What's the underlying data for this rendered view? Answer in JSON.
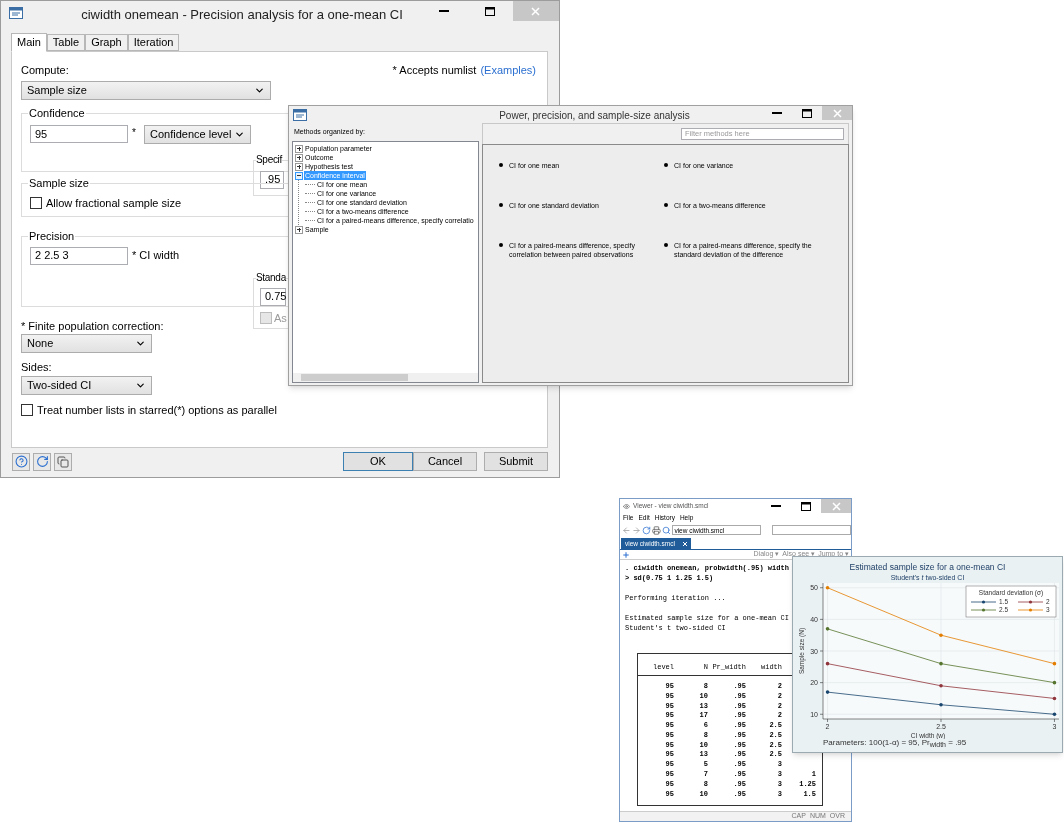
{
  "dialog": {
    "title": "ciwidth onemean - Precision analysis for a one-mean CI",
    "tabs": [
      {
        "label": "Main",
        "selected": true
      },
      {
        "label": "Table",
        "selected": false
      },
      {
        "label": "Graph",
        "selected": false
      },
      {
        "label": "Iteration",
        "selected": false
      }
    ],
    "compute_label": "Compute:",
    "compute_value": "Sample size",
    "numlist_note": "* Accepts numlist",
    "examples_link": "(Examples)",
    "confidence": {
      "legend": "Confidence",
      "value": "95",
      "star": "*",
      "type": "Confidence level",
      "specify_legend": "Specif",
      "specify_value": ".95"
    },
    "sample_size": {
      "legend": "Sample size",
      "checkbox": {
        "label": "Allow fractional sample size",
        "checked": false
      }
    },
    "precision": {
      "legend": "Precision",
      "value": "2 2.5 3",
      "label": "* CI width",
      "std_legend": "Standa",
      "std_value": "0.75",
      "std_checkbox": {
        "label": "As",
        "checked": false,
        "disabled": true
      }
    },
    "fpc": {
      "label": "* Finite population correction:",
      "value": "None"
    },
    "sides": {
      "label": "Sides:",
      "value": "Two-sided CI"
    },
    "parallel": {
      "label": "Treat number lists in starred(*) options as parallel",
      "checked": false
    },
    "buttons": [
      {
        "label": "OK",
        "default": true
      },
      {
        "label": "Cancel",
        "default": false
      },
      {
        "label": "Submit",
        "default": false
      }
    ]
  },
  "pss": {
    "title": "Power, precision, and sample-size analysis",
    "methods_label": "Methods organized by:",
    "filter_placeholder": "Filter methods here",
    "tree": [
      {
        "label": "Population parameter",
        "expanded": false,
        "selected": false
      },
      {
        "label": "Outcome",
        "expanded": false,
        "selected": false
      },
      {
        "label": "Hypothesis test",
        "expanded": false,
        "selected": false
      },
      {
        "label": "Confidence interval",
        "expanded": true,
        "selected": true,
        "children": [
          {
            "label": "CI for one mean",
            "selected": false
          },
          {
            "label": "CI for one variance",
            "selected": false
          },
          {
            "label": "CI for one standard deviation",
            "selected": false
          },
          {
            "label": "CI for a two-means difference",
            "selected": false
          },
          {
            "label": "CI for a paired-means difference, specify correlatio",
            "selected": false
          }
        ]
      },
      {
        "label": "Sample",
        "expanded": false,
        "selected": false
      }
    ],
    "methods": [
      "CI for one mean",
      "CI for one variance",
      "CI for one standard deviation",
      "CI for a two-means difference",
      "CI for a paired-means difference, specify correlation between paired observations",
      "CI for a paired-means difference, specify the standard deviation of the difference"
    ]
  },
  "viewer": {
    "title": "Viewer - view ciwidth.smcl",
    "menu": [
      "File",
      "Edit",
      "History",
      "Help"
    ],
    "address": "view ciwidth.smcl",
    "tab": "view ciwidth.smcl",
    "toolbar": [
      "Dialog ▾",
      "Also see ▾",
      "Jump to ▾"
    ],
    "blocks": [
      {
        "kind": "command",
        "lines": [
          ". ciwidth onemean, probwidth(.95) width",
          "> sd(0.75 1 1.25 1.5)"
        ]
      },
      {
        "kind": "output",
        "lines": [
          "Performing iteration ..."
        ]
      },
      {
        "kind": "output",
        "lines": [
          "Estimated sample size for a one-mean CI",
          "Student's t two-sided CI"
        ]
      }
    ],
    "columns": [
      "level",
      "N",
      "Pr_width",
      "width"
    ],
    "rows": [
      {
        "cells": [
          "95",
          "8",
          ".95",
          "2"
        ]
      },
      {
        "cells": [
          "95",
          "10",
          ".95",
          "2"
        ]
      },
      {
        "cells": [
          "95",
          "13",
          ".95",
          "2"
        ]
      },
      {
        "cells": [
          "95",
          "17",
          ".95",
          "2"
        ]
      },
      {
        "cells": [
          "95",
          "6",
          ".95",
          "2.5"
        ]
      },
      {
        "cells": [
          "95",
          "8",
          ".95",
          "2.5"
        ]
      },
      {
        "cells": [
          "95",
          "10",
          ".95",
          "2.5"
        ]
      },
      {
        "cells": [
          "95",
          "13",
          ".95",
          "2.5"
        ]
      },
      {
        "cells": [
          "95",
          "5",
          ".95",
          "3"
        ]
      },
      {
        "cells": [
          "95",
          "7",
          ".95",
          "3",
          "1"
        ]
      },
      {
        "cells": [
          "95",
          "8",
          ".95",
          "3",
          "1.25"
        ]
      },
      {
        "cells": [
          "95",
          "10",
          ".95",
          "3",
          "1.5"
        ]
      }
    ],
    "status": [
      "CAP",
      "NUM",
      "OVR"
    ]
  },
  "graph": {
    "subtitle": "Student's *t* two-sided CI",
    "footnote": "Parameters: 100(1-α) = 95, Pr$_{width}$ = .95",
    "chart_data": {
      "type": "line",
      "title": "Estimated sample size for a one-mean CI",
      "xlabel": "CI width (w)",
      "ylabel": "Sample size (N)",
      "x": [
        2,
        2.5,
        3
      ],
      "xticks": [
        2,
        2.5,
        3
      ],
      "yticks": [
        10,
        20,
        30,
        40,
        50
      ],
      "xlim": [
        1.98,
        3.02
      ],
      "ylim": [
        8.5,
        51.5
      ],
      "grid": true,
      "legend": {
        "title": "Standard deviation (σ)"
      },
      "series": [
        {
          "name": "1.5",
          "color": "#1a476f",
          "values": [
            17,
            13,
            10
          ]
        },
        {
          "name": "2",
          "color": "#90353b",
          "values": [
            26,
            19,
            15
          ]
        },
        {
          "name": "2.5",
          "color": "#55752f",
          "values": [
            37,
            26,
            20
          ]
        },
        {
          "name": "3",
          "color": "#e37e00",
          "values": [
            50,
            35,
            26
          ]
        }
      ]
    }
  }
}
